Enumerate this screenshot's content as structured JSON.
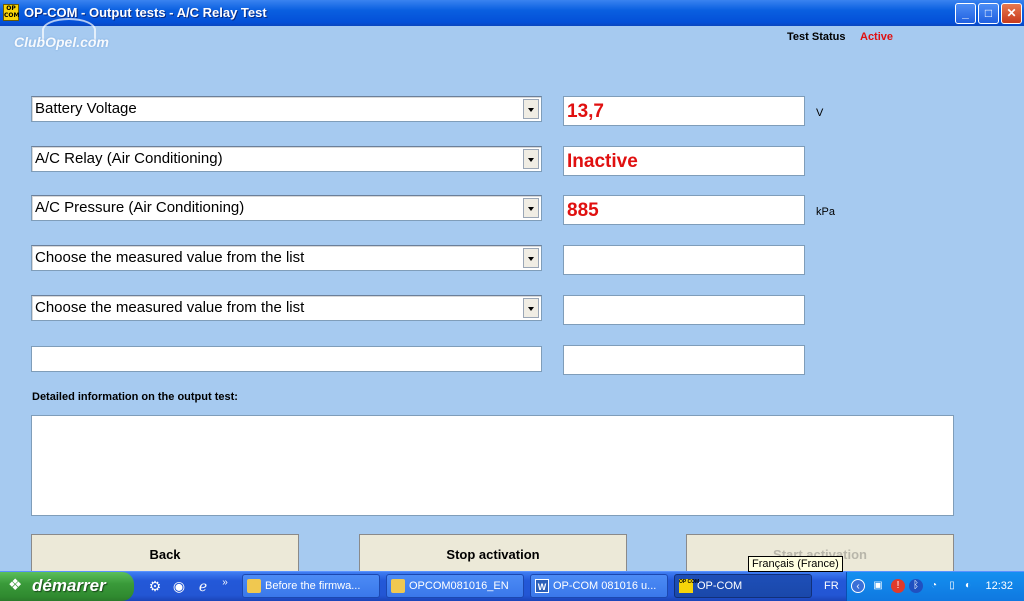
{
  "window": {
    "app_icon": "OP COM",
    "title": "OP-COM - Output tests - A/C Relay Test",
    "logo": "ClubOpel.com",
    "controls": {
      "minimize": "_",
      "maximize": "□",
      "close": "✕"
    }
  },
  "status": {
    "label": "Test Status",
    "value": "Active",
    "value_color": "#e01010"
  },
  "measurements": [
    {
      "selection": "Battery Voltage",
      "value": "13,7",
      "unit": "V"
    },
    {
      "selection": "A/C Relay (Air Conditioning)",
      "value": "Inactive",
      "unit": ""
    },
    {
      "selection": "A/C Pressure (Air Conditioning)",
      "value": "885",
      "unit": "kPa"
    },
    {
      "selection": "Choose the measured value from the list",
      "value": "",
      "unit": ""
    },
    {
      "selection": "Choose the measured value from the list",
      "value": "",
      "unit": ""
    },
    {
      "selection": "",
      "value": "",
      "unit": ""
    }
  ],
  "info": {
    "label": "Detailed information on the output test:",
    "text": ""
  },
  "buttons": {
    "back": "Back",
    "stop": "Stop activation",
    "start": "Start activation"
  },
  "tooltip": "Français (France)",
  "taskbar": {
    "start_label": "démarrer",
    "tasks": [
      {
        "label": "Before the firmwa...",
        "icon": "folder-icon"
      },
      {
        "label": "OPCOM081016_EN",
        "icon": "folder-icon"
      },
      {
        "label": "OP-COM 081016 u...",
        "icon": "word-icon"
      },
      {
        "label": "OP-COM",
        "icon": "opcom-icon"
      }
    ],
    "lang": "FR",
    "clock": "12:32"
  }
}
